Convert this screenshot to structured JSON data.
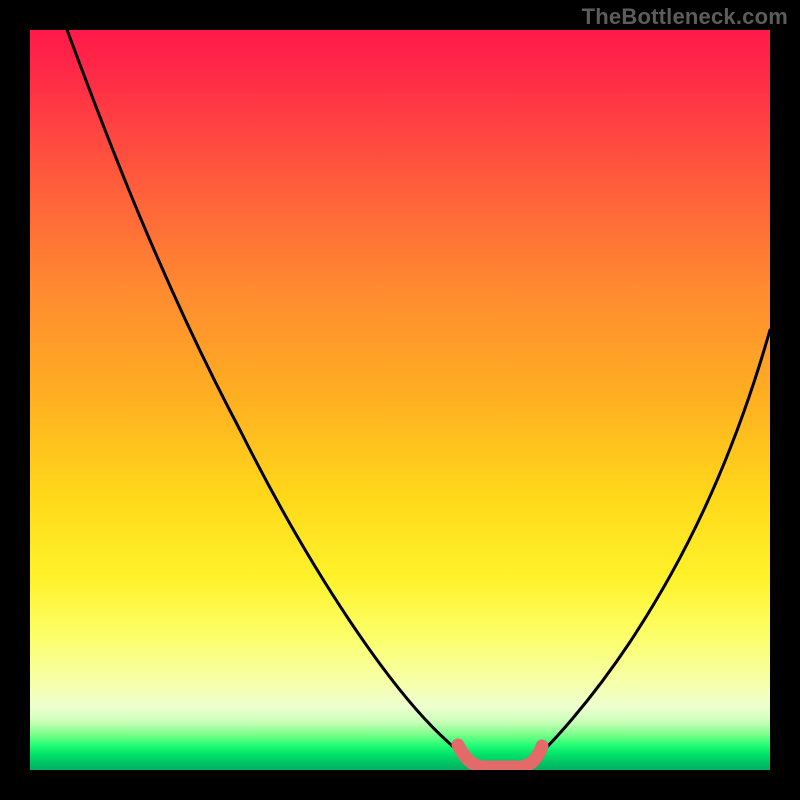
{
  "watermark": "TheBottleneck.com",
  "colors": {
    "page_bg": "#000000",
    "watermark": "#5c5c5c",
    "curve_stroke": "#000000",
    "bottom_marker": "#e46a6a",
    "gradient_stops": [
      "#ff1a4a",
      "#ff5a3c",
      "#ffb021",
      "#fff22a",
      "#edffd0",
      "#2bff77",
      "#00b061"
    ]
  },
  "chart_data": {
    "type": "line",
    "title": "",
    "xlabel": "",
    "ylabel": "",
    "xlim": [
      0,
      100
    ],
    "ylim": [
      0,
      100
    ],
    "grid": false,
    "legend_position": "none",
    "series": [
      {
        "name": "left-branch",
        "x": [
          5,
          10,
          15,
          20,
          25,
          30,
          35,
          40,
          45,
          50,
          55,
          58,
          60
        ],
        "y": [
          100,
          92,
          84,
          75,
          66,
          56,
          46,
          36,
          26,
          17,
          8,
          3,
          0.5
        ]
      },
      {
        "name": "right-branch",
        "x": [
          67,
          70,
          75,
          80,
          85,
          90,
          95,
          100
        ],
        "y": [
          0.5,
          4,
          12,
          22,
          33,
          44,
          54,
          60
        ]
      },
      {
        "name": "bottom-segment",
        "x": [
          58,
          60,
          62,
          64,
          66,
          67.5
        ],
        "y": [
          3.0,
          1.0,
          0.4,
          0.4,
          1.0,
          3.0
        ]
      }
    ],
    "annotations": [
      {
        "text": "TheBottleneck.com",
        "position": "top-right"
      }
    ]
  }
}
